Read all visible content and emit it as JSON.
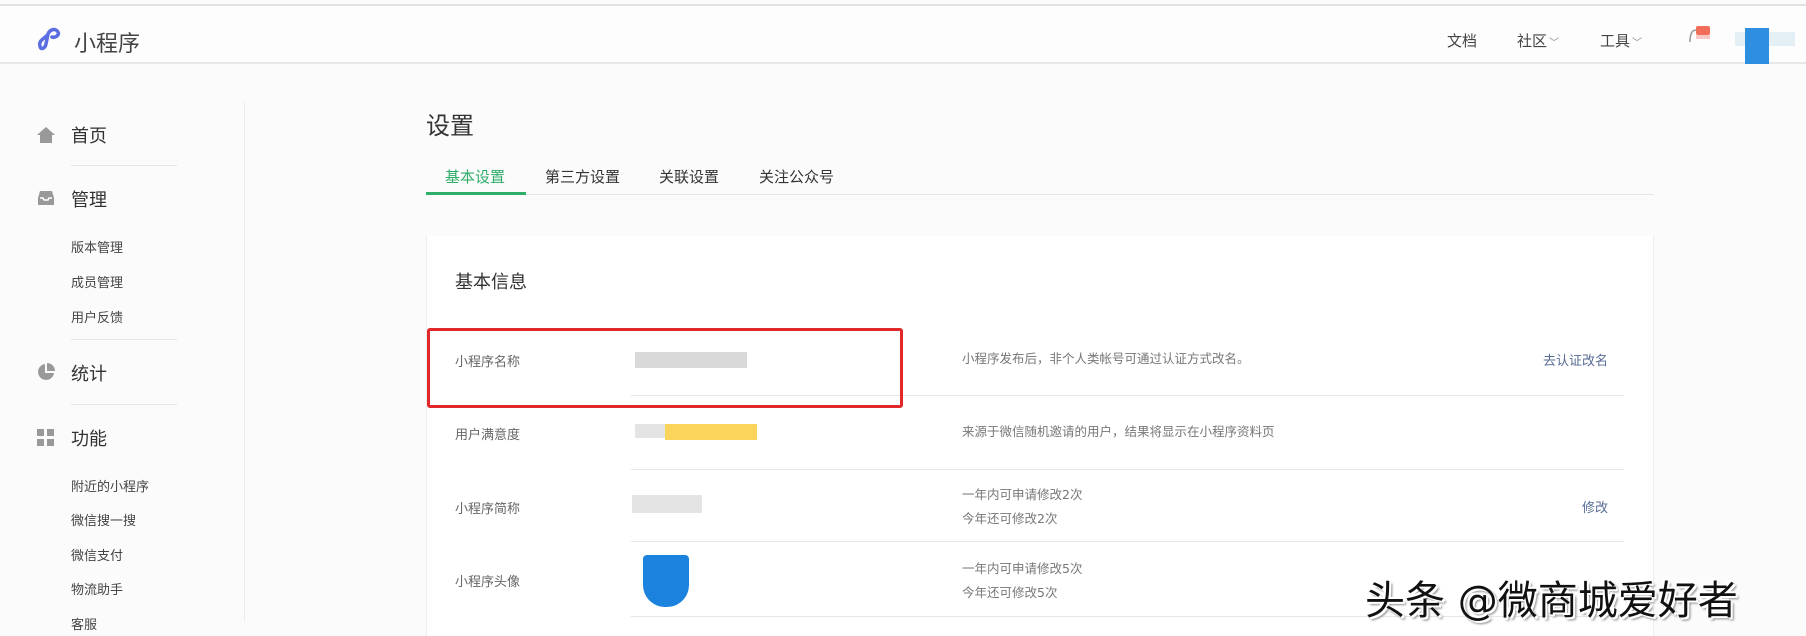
{
  "header": {
    "brand": "小程序",
    "nav": [
      {
        "label": "文档"
      },
      {
        "label": "社区",
        "chevron": "﹀"
      },
      {
        "label": "工具",
        "chevron": "﹀"
      }
    ]
  },
  "sidebar": {
    "home": "首页",
    "manage": {
      "label": "管理",
      "items": [
        "版本管理",
        "成员管理",
        "用户反馈"
      ]
    },
    "stats": "统计",
    "features": {
      "label": "功能",
      "items": [
        "附近的小程序",
        "微信搜一搜",
        "微信支付",
        "物流助手",
        "客服"
      ]
    }
  },
  "page": {
    "title": "设置",
    "tabs": [
      "基本设置",
      "第三方设置",
      "关联设置",
      "关注公众号"
    ],
    "active_tab": 0
  },
  "card": {
    "title": "基本信息",
    "rows": [
      {
        "label": "小程序名称",
        "desc": "小程序发布后，非个人类帐号可通过认证方式改名。",
        "action": "去认证改名"
      },
      {
        "label": "用户满意度",
        "desc": "来源于微信随机邀请的用户，结果将显示在小程序资料页"
      },
      {
        "label": "小程序简称",
        "desc1": "一年内可申请修改2次",
        "desc2": "今年还可修改2次",
        "action": "修改"
      },
      {
        "label": "小程序头像",
        "desc1": "一年内可申请修改5次",
        "desc2": "今年还可修改5次"
      }
    ]
  },
  "watermark": "头条 @微商城爱好者",
  "colors": {
    "accent": "#2fae6a",
    "link": "#576b95",
    "highlight": "#e0282a",
    "logo": "#5b6ee1"
  }
}
